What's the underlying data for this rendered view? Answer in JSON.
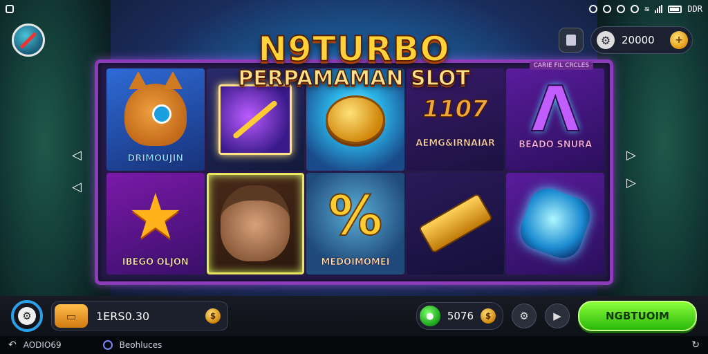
{
  "statusbar": {
    "right_label": "DDR",
    "left_icon": "square-outline-icon"
  },
  "header": {
    "title": "N9TURBO",
    "subtitle": "PERPAMAMAN SLOT",
    "coin_balance": "20000"
  },
  "frame_tag": "CARIE FIL CRCLES",
  "reels": [
    {
      "label": "DRIMOUJIN",
      "icon": "fox-icon"
    },
    {
      "label": "",
      "icon": "pen-card-icon"
    },
    {
      "label": "",
      "icon": "gold-coin-icon"
    },
    {
      "label": "AEMG&IRNAIAR",
      "icon": "number-badge-icon",
      "badge_text": "1107"
    },
    {
      "label": "BEADO SNURA",
      "icon": "purple-arrow-icon"
    },
    {
      "label": "IBEGO OLJON",
      "icon": "star-icon"
    },
    {
      "label": "",
      "icon": "hero-portrait-icon"
    },
    {
      "label": "MEDOIMOMEI",
      "icon": "percent-icon"
    },
    {
      "label": "",
      "icon": "gold-bar-icon"
    },
    {
      "label": "",
      "icon": "blue-orb-icon"
    }
  ],
  "bottom_bar": {
    "balance": "1ERS0.30",
    "win_amount": "5076",
    "cta_label": "NGBTUOIM"
  },
  "footer": {
    "left_text": "AODIO69",
    "mid_text": "Beohluces"
  },
  "colors": {
    "accent_green": "#2ab80a",
    "frame_purple": "#8c3cb8",
    "gold": "#ffd23a"
  }
}
